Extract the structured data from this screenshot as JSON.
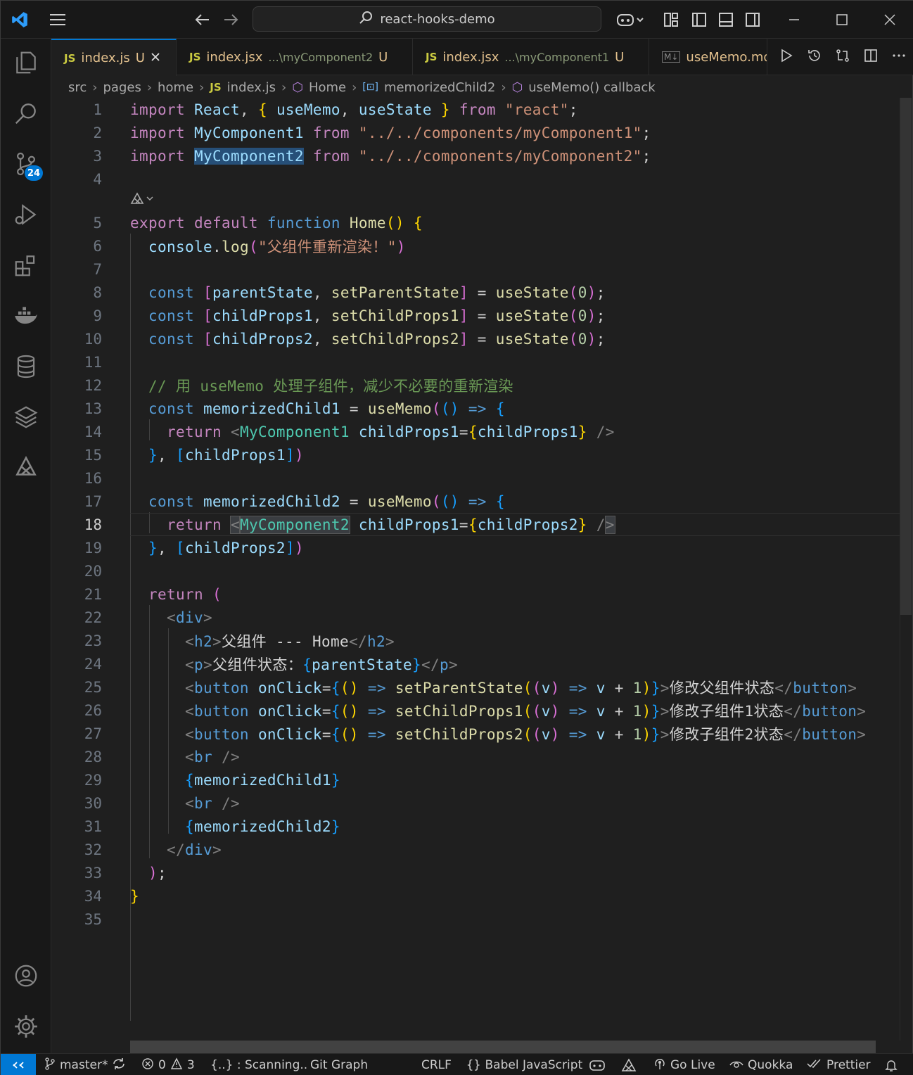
{
  "titlebar": {
    "search_text": "react-hooks-demo"
  },
  "tabs": [
    {
      "icon": "JS",
      "name": "index.js",
      "path": "",
      "status": "U"
    },
    {
      "icon": "JS",
      "name": "index.jsx",
      "path": "...\\myComponent2",
      "status": "U"
    },
    {
      "icon": "JS",
      "name": "index.jsx",
      "path": "...\\myComponent1",
      "status": "U"
    },
    {
      "icon": "M↓",
      "name": "useMemo.md",
      "path": "",
      "status": ""
    }
  ],
  "breadcrumb": [
    "src",
    "pages",
    "home",
    "index.js",
    "Home",
    "memorizedChild2",
    "useMemo() callback"
  ],
  "scm_badge": "24",
  "editor": {
    "current_line": "18"
  },
  "status": {
    "branch": "master*",
    "errors": "0",
    "warnings": "3",
    "scanning": "{..} : Scanning..",
    "git_graph": "Git Graph",
    "eol": "CRLF",
    "language": "Babel JavaScript",
    "golive": "Go Live",
    "quokka": "Quokka",
    "prettier": "Prettier"
  },
  "colors": {
    "accent": "#0078d4",
    "background": "#1f1f1f",
    "keyword": "#c586c0",
    "string": "#ce9178",
    "comment": "#6a9955"
  }
}
